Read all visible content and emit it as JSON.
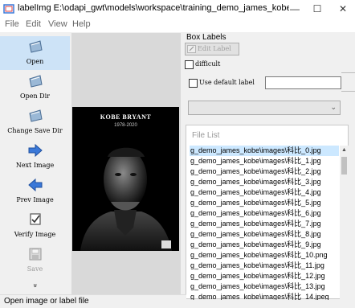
{
  "window": {
    "title": "labelImg E:\\odapi_gwt\\models\\workspace\\training_demo_james_kobe\\i...",
    "min_symbol": "—",
    "max_symbol": "☐",
    "close_symbol": "✕"
  },
  "menu": [
    "File",
    "Edit",
    "View",
    "Help"
  ],
  "toolbar": {
    "open": "Open",
    "open_dir": "Open Dir",
    "change_save_dir": "Change Save Dir",
    "next_image": "Next Image",
    "prev_image": "Prev Image",
    "verify_image": "Verify Image",
    "save": "Save",
    "more": "»"
  },
  "photo": {
    "title": "KOBE BRYANT",
    "years": "1978-2020"
  },
  "box_labels": {
    "title": "Box Labels",
    "edit_label": "Edit Label",
    "difficult": "difficult",
    "use_default_label": "Use default label",
    "default_label_value": ""
  },
  "file_list": {
    "title": "File List",
    "items": [
      "g_demo_james_kobe\\images\\科比_0.jpg",
      "g_demo_james_kobe\\images\\科比_1.jpg",
      "g_demo_james_kobe\\images\\科比_2.jpg",
      "g_demo_james_kobe\\images\\科比_3.jpg",
      "g_demo_james_kobe\\images\\科比_4.jpg",
      "g_demo_james_kobe\\images\\科比_5.jpg",
      "g_demo_james_kobe\\images\\科比_6.jpg",
      "g_demo_james_kobe\\images\\科比_7.jpg",
      "g_demo_james_kobe\\images\\科比_8.jpg",
      "g_demo_james_kobe\\images\\科比_9.jpg",
      "g_demo_james_kobe\\images\\科比_10.png",
      "g_demo_james_kobe\\images\\科比_11.jpg",
      "g_demo_james_kobe\\images\\科比_12.jpg",
      "g_demo_james_kobe\\images\\科比_13.jpg",
      "g_demo_james_kobe\\images\\科比_14.jpeg"
    ]
  },
  "status": "Open image or label file",
  "colors": {
    "accent_blue": "#3a78d8",
    "selected_bg": "#cde3f7",
    "list_selected": "#cce8ff"
  }
}
